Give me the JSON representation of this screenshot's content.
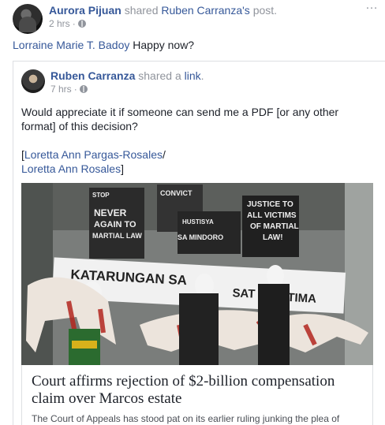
{
  "post": {
    "author": "Aurora Pijuan",
    "action_prefix": "shared",
    "shared_from": "Ruben Carranza's",
    "action_suffix": "post.",
    "time": "2 hrs",
    "more_icon": "…",
    "mention": "Lorraine Marie T. Badoy",
    "message": " Happy now?"
  },
  "shared": {
    "author": "Ruben Carranza",
    "action_prefix": "shared a",
    "action_link": "link",
    "action_suffix": ".",
    "time": "7 hrs",
    "body_line": "Would appreciate it if someone can send me a PDF [or any other format] of this decision?",
    "bracket_open": "[",
    "mention1": "Loretta Ann Pargas-Rosales",
    "slash": "/",
    "mention2": "Loretta Ann Rosales",
    "bracket_close": "]"
  },
  "link_preview": {
    "title": "Court affirms rejection of $2-billion compensation claim over Marcos estate",
    "description": "The Court of Appeals has stood pat on its earlier ruling junking the plea of",
    "photo_signs": [
      "NEVER",
      "AGAIN TO",
      "MARTIAL LAW",
      "JUSTICE TO",
      "ALL VICTIMS",
      "OF MARTIAL",
      "LAW!",
      "HUSTISYA",
      "SA MINDORO",
      "KATARUNGAN SA",
      "SAT NG",
      "TIMA",
      "CONVICT",
      "STOP"
    ]
  }
}
